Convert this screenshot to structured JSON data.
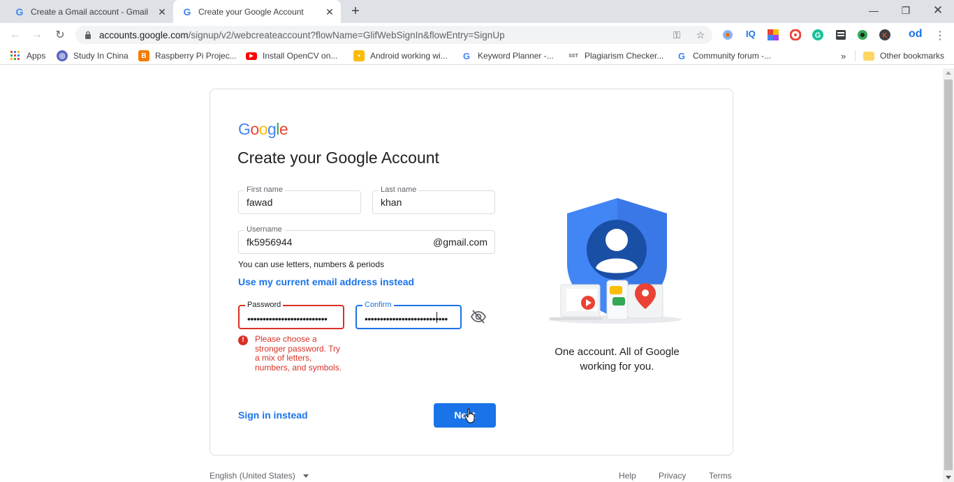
{
  "browser": {
    "tabs": [
      {
        "title": "Create a Gmail account - Gmail H",
        "favicon": "google-g-icon"
      },
      {
        "title": "Create your Google Account",
        "favicon": "google-g-icon"
      }
    ],
    "new_tab_label": "+",
    "url_host": "accounts.google.com",
    "url_path": "/signup/v2/webcreateaccount?flowName=GlifWebSignIn&flowEntry=SignUp",
    "bookmarks": [
      {
        "label": "Apps",
        "icon": "apps-grid-icon"
      },
      {
        "label": "Study In China",
        "icon": "globe-icon"
      },
      {
        "label": "Raspberry Pi Projec...",
        "icon": "blogger-icon"
      },
      {
        "label": "Install OpenCV on...",
        "icon": "youtube-icon"
      },
      {
        "label": "Android working wi...",
        "icon": "bookmark-yellow-icon"
      },
      {
        "label": "Keyword Planner -...",
        "icon": "google-g-icon"
      },
      {
        "label": "Plagiarism Checker...",
        "icon": "sst-icon"
      },
      {
        "label": "Community forum -...",
        "icon": "google-g-icon"
      }
    ],
    "overflow_label": "»",
    "other_bookmarks": "Other bookmarks"
  },
  "signup": {
    "logo_text": "Google",
    "title": "Create your Google Account",
    "first_name_label": "First name",
    "first_name_value": "fawad",
    "last_name_label": "Last name",
    "last_name_value": "khan",
    "username_label": "Username",
    "username_value": "fk5956944",
    "username_suffix": "@gmail.com",
    "username_hint": "You can use letters, numbers & periods",
    "use_email_link": "Use my current email address instead",
    "password_label": "Password",
    "password_mask": "••••••••••••••••••••••••••",
    "confirm_label": "Confirm",
    "confirm_mask": "•••••••••••••••••••••••••••",
    "error_text": "Please choose a stronger password. Try a mix of letters, numbers, and symbols.",
    "sign_in_link": "Sign in instead",
    "next_button": "Next",
    "tagline": "One account. All of Google working for you."
  },
  "footer": {
    "language": "English (United States)",
    "help": "Help",
    "privacy": "Privacy",
    "terms": "Terms"
  },
  "colors": {
    "accent": "#1a73e8",
    "error": "#d93025",
    "shield": "#4285f4"
  }
}
